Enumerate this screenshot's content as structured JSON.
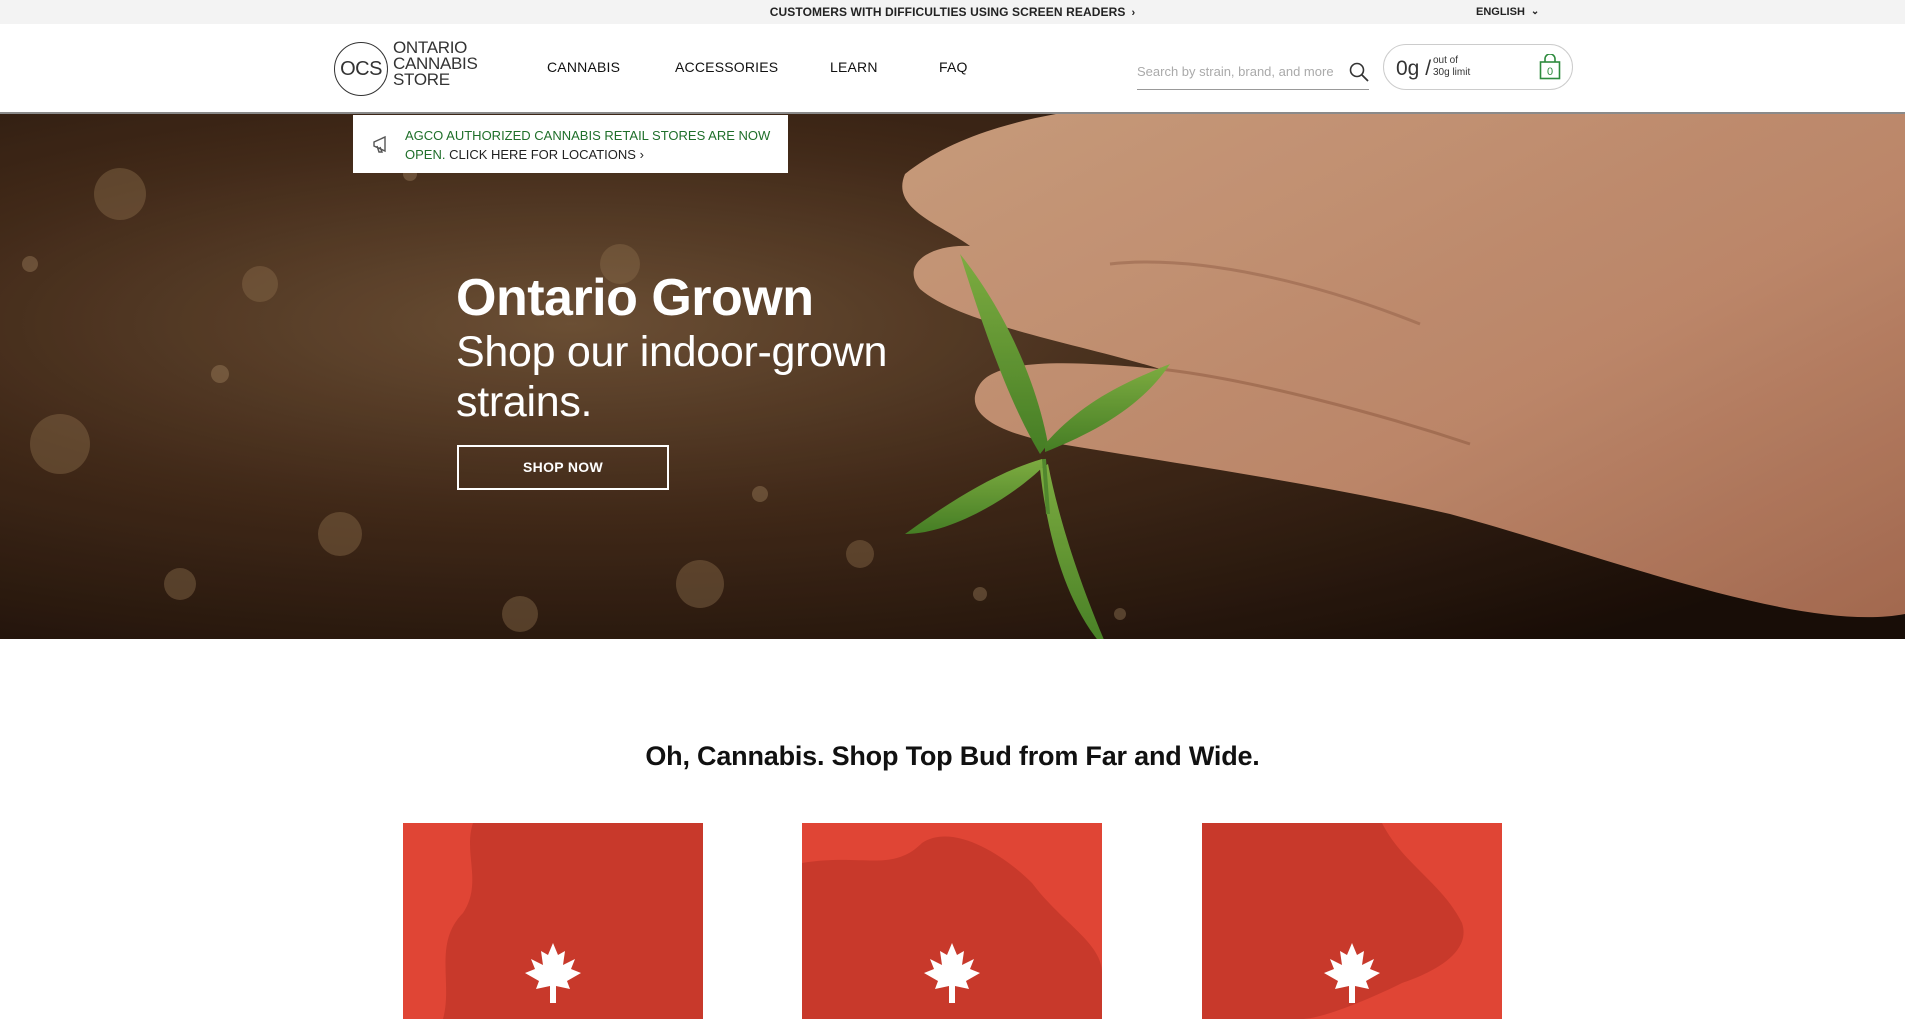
{
  "topbar": {
    "a11y_text": "CUSTOMERS WITH DIFFICULTIES USING SCREEN READERS",
    "a11y_chevron": "›",
    "language": "ENGLISH",
    "language_chevron": "⌄"
  },
  "header": {
    "logo": {
      "mark": "OCS",
      "line1": "ONTARIO",
      "line2": "CANNABIS",
      "line3": "STORE"
    },
    "nav": [
      "CANNABIS",
      "ACCESSORIES",
      "LEARN",
      "FAQ"
    ],
    "search_placeholder": "Search by strain, brand, and more",
    "cart": {
      "grams": "0g /",
      "limit_line1": "out of",
      "limit_line2": "30g limit",
      "count": "0"
    },
    "icons": {
      "search": "search-icon",
      "bag": "shopping-bag-icon"
    }
  },
  "notice": {
    "text": "AGCO AUTHORIZED CANNABIS RETAIL STORES ARE NOW OPEN.",
    "link": "CLICK HERE FOR LOCATIONS",
    "chevron": "›",
    "icon": "megaphone-icon"
  },
  "hero": {
    "title": "Ontario Grown",
    "subtitle": "Shop our indoor-grown strains.",
    "button": "SHOP NOW"
  },
  "section": {
    "title": "Oh, Cannabis. Shop Top Bud from Far and Wide."
  },
  "cards": [
    {
      "icon": "maple-leaf-icon"
    },
    {
      "icon": "maple-leaf-icon"
    },
    {
      "icon": "maple-leaf-icon"
    }
  ],
  "colors": {
    "card_red": "#e04535",
    "card_dark_red": "#c8392b",
    "notice_green": "#1f6f2a",
    "topbar_bg": "#f3f3f3"
  }
}
